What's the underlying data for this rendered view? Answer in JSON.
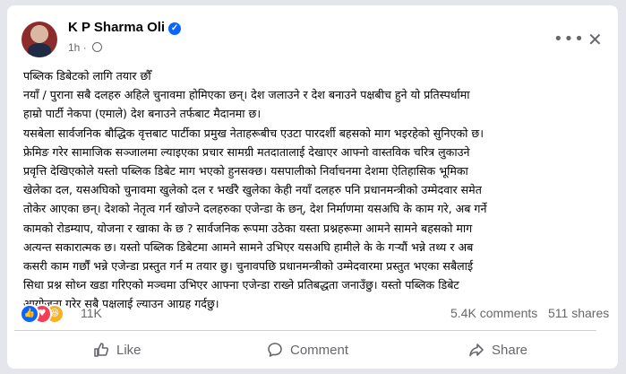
{
  "post": {
    "author": "K P Sharma Oli",
    "time": "1h",
    "separator": "·",
    "lines": [
      "पब्लिक डिबेटको लागि तयार छौँ",
      "नयाँ / पुराना सबै दलहरु अहिले चुनावमा होमिएका छन्। देश जलाउने र देश बनाउने पक्षबीच हुने यो प्रतिस्पर्धामा",
      "हाम्रो पार्टी नेकपा (एमाले) देश बनाउने तर्फबाट मैदानमा छ।",
      "यसबेला सार्वजनिक बौद्धिक वृत्तबाट पार्टीका प्रमुख नेताहरूबीच एउटा पारदर्शी बहसको माग भइरहेको सुनिएको छ।",
      "फ्रेमिङ गरेर सामाजिक सञ्जालमा ल्याइएका प्रचार सामग्री मतदातालाई देखाएर आफ्नो वास्तविक चरित्र लुकाउने",
      "प्रवृत्ति देखिएकोले यस्तो पब्लिक डिबेट माग भएको हुनसक्छ। यसपालीको निर्वाचनमा देशमा ऐतिहासिक भूमिका",
      "खेलेका दल, यसअघिको चुनावमा खुलेको दल र भर्खरै खुलेका केही नयाँ दलहरु पनि प्रधानमन्त्रीको उम्मेदवार समेत",
      "तोकेर आएका छन्। देशको नेतृत्व गर्न खोज्ने दलहरुका एजेन्डा के छन्, देश निर्माणमा यसअघि के काम गरे, अब गर्ने",
      "कामको रोडम्याप, योजना र  खाका के छ ? सार्वजनिक रूपमा उठेका यस्ता प्रश्नहरूमा आमने सामने बहसको माग",
      "अत्यन्त सकारात्मक छ। यस्तो पब्लिक डिबेटमा आमने सामने उभिएर यसअघि हामीले के के गर्‍यौं भन्ने तथ्य र अब",
      "कसरी काम गर्छौं भन्ने एजेन्डा प्रस्तुत गर्न म तयार छु। चुनावपछि प्रधानमन्त्रीको उम्मेदवारमा प्रस्तुत भएका सबैलाई",
      "सिधा प्रश्न सोध्न खडा गरिएको मञ्चमा उभिएर आफ्ना एजेन्डा राख्ने प्रतिबद्धता जनाउँछु।  यस्तो पब्लिक डिबेट",
      "आयोजना गरेर सबै पक्षलाई ल्याउन आग्रह गर्दछु।"
    ]
  },
  "stats": {
    "reactions": "11K",
    "comments": "5.4K comments",
    "shares": "511 shares"
  },
  "actions": {
    "like": "Like",
    "comment": "Comment",
    "share": "Share"
  },
  "icons": {
    "verified": "verified-badge-icon",
    "audience": "globe-icon",
    "more": "more-options-icon",
    "close": "close-icon"
  },
  "colors": {
    "accent": "#0866ff",
    "love": "#f33e58",
    "haha": "#f7b125",
    "secondary_text": "#65676b"
  }
}
